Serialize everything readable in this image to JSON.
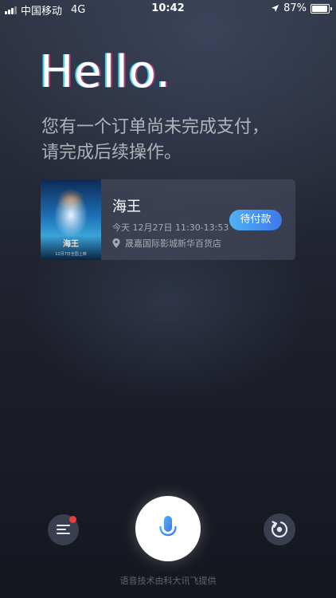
{
  "status_bar": {
    "carrier": "中国移动",
    "network": "4G",
    "time": "10:42",
    "battery": "87%",
    "battery_level": 0.87,
    "icons": [
      "signal-icon",
      "location-arrow-icon",
      "battery-icon"
    ]
  },
  "greeting": {
    "title": "Hello.",
    "message_line1": "您有一个订单尚未完成支付，",
    "message_line2": "请完成后续操作。"
  },
  "order": {
    "poster_title": "海王",
    "poster_fine_print": "12月7日全国上映",
    "movie_title": "海王",
    "time": "今天 12月27日 11:30-13:53",
    "location": "晟嘉国际影城新华百货店",
    "status_button": "待付款",
    "button_color": "#3d78ec",
    "icons": [
      "location-pin-icon"
    ]
  },
  "controls": {
    "icons": [
      "menu-icon",
      "microphone-icon",
      "replay-icon"
    ],
    "notification_dot_color": "#ec3d3d",
    "credit": "语音技术由科大讯飞提供"
  }
}
